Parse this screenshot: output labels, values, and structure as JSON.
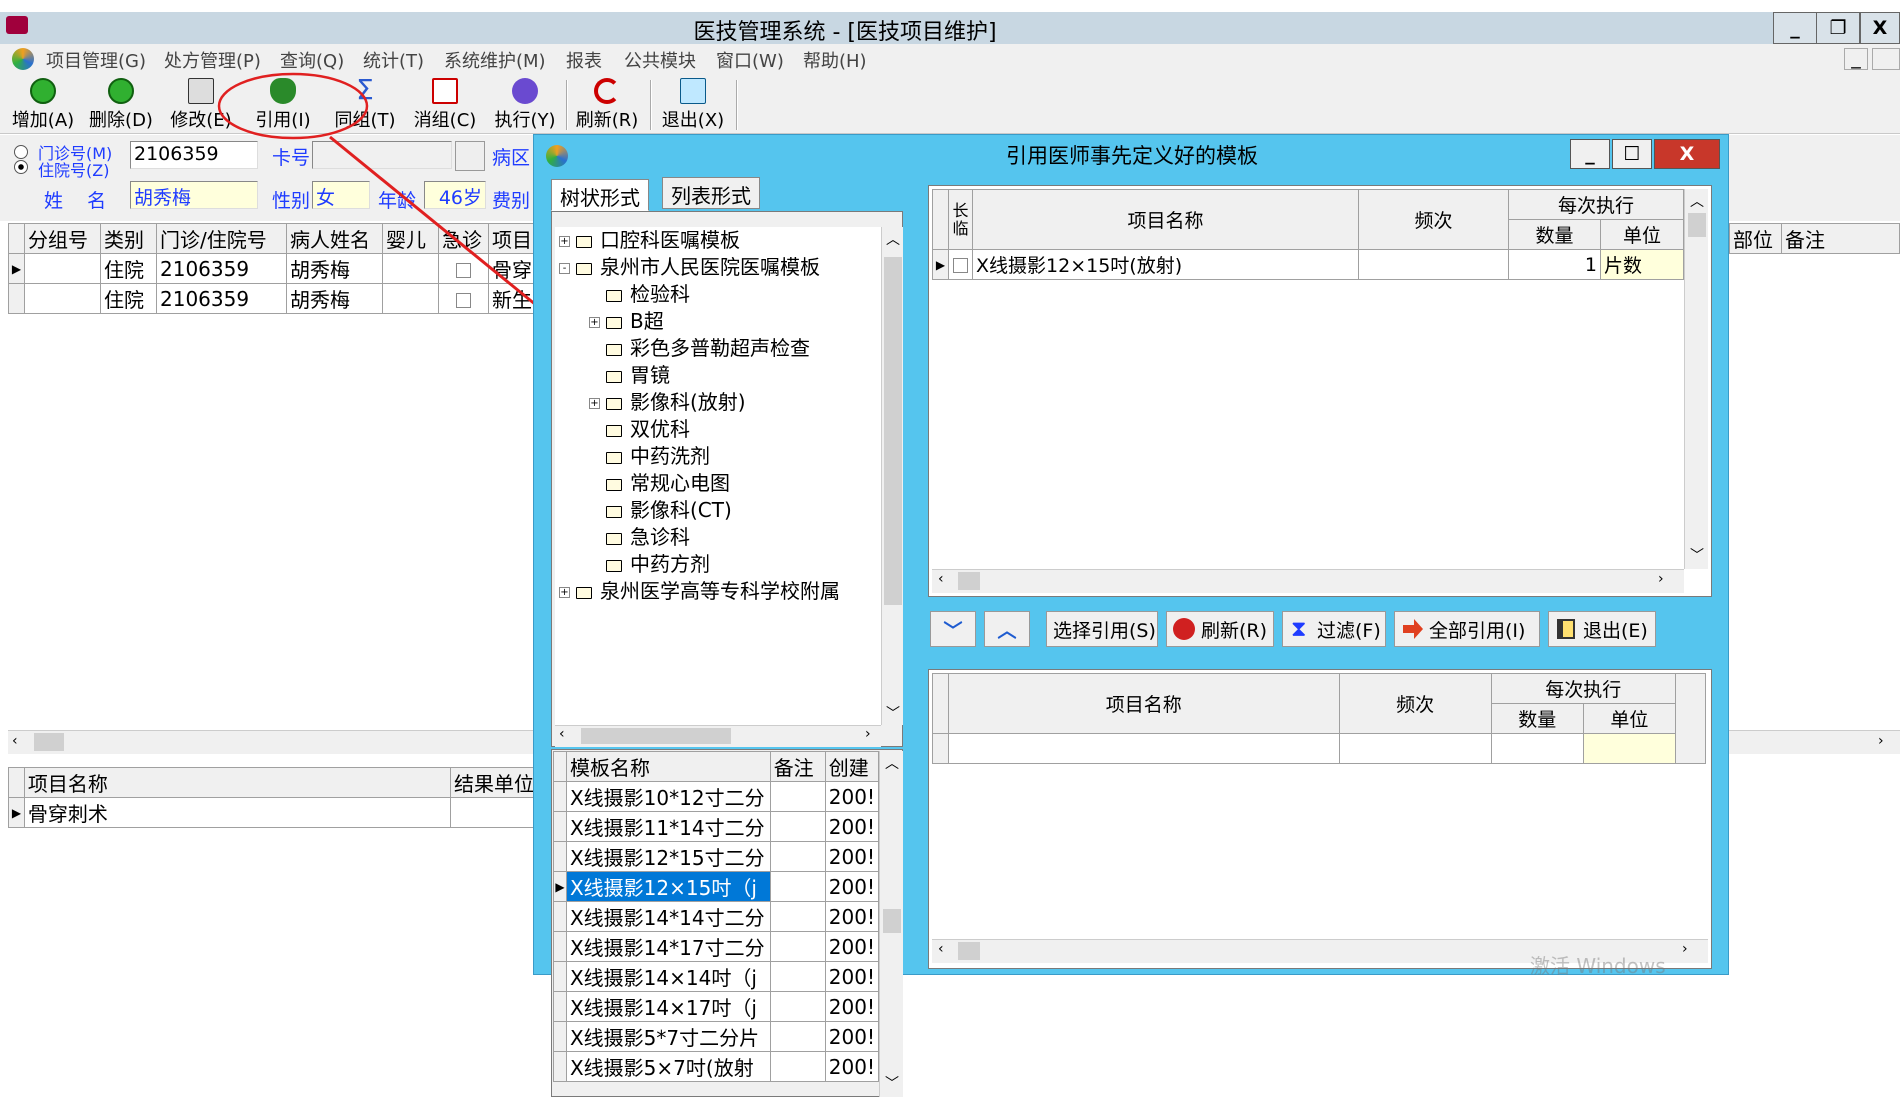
{
  "window": {
    "title": "医技管理系统 - [医技项目维护]",
    "min": "_",
    "max": "❐",
    "close": "X"
  },
  "menu": [
    "项目管理(G)",
    "处方管理(P)",
    "查询(Q)",
    "统计(T)",
    "系统维护(M)",
    "报表",
    "公共模块",
    "窗口(W)",
    "帮助(H)"
  ],
  "toolbar": {
    "add": "增加(A)",
    "delete": "删除(D)",
    "edit": "修改(E)",
    "ref": "引用(I)",
    "group": "同组(T)",
    "cancel": "消组(C)",
    "exec": "执行(Y)",
    "refresh": "刷新(R)",
    "exit": "退出(X)"
  },
  "patient": {
    "outpatient_label": "门诊号(M)",
    "inpatient_label": "住院号(Z)",
    "number": "2106359",
    "card_label": "卡号",
    "card_value": "",
    "ward_label": "病区",
    "name_label": "姓    名",
    "name": "胡秀梅",
    "sex_label": "性别",
    "sex": "女",
    "age_label": "年龄",
    "age": "46岁",
    "fee_label": "费别"
  },
  "main_grid": {
    "headers": [
      "分组号",
      "类别",
      "门诊/住院号",
      "病人姓名",
      "婴儿",
      "急诊",
      "项目"
    ],
    "right_headers": [
      "部位",
      "备注"
    ],
    "rows": [
      [
        "",
        "住院",
        "2106359",
        "胡秀梅",
        "",
        "",
        "骨穿"
      ],
      [
        "",
        "住院",
        "2106359",
        "胡秀梅",
        "",
        "",
        "新生"
      ]
    ]
  },
  "bottom_grid": {
    "headers": [
      "项目名称",
      "结果单位"
    ],
    "rows": [
      [
        "骨穿刺术",
        ""
      ]
    ]
  },
  "dialog": {
    "title": "引用医师事先定义好的模板",
    "tab_tree": "树状形式",
    "tab_list": "列表形式",
    "tree": [
      {
        "label": "口腔科医嘱模板",
        "level": 0,
        "expander": "+"
      },
      {
        "label": "泉州市人民医院医嘱模板",
        "level": 0,
        "expander": "-"
      },
      {
        "label": "检验科",
        "level": 1,
        "expander": ""
      },
      {
        "label": "B超",
        "level": 1,
        "expander": "+"
      },
      {
        "label": "彩色多普勒超声检查",
        "level": 1,
        "expander": ""
      },
      {
        "label": "胃镜",
        "level": 1,
        "expander": ""
      },
      {
        "label": "影像科(放射)",
        "level": 1,
        "expander": "+"
      },
      {
        "label": "双优科",
        "level": 1,
        "expander": ""
      },
      {
        "label": "中药洗剂",
        "level": 1,
        "expander": ""
      },
      {
        "label": "常规心电图",
        "level": 1,
        "expander": ""
      },
      {
        "label": "影像科(CT)",
        "level": 1,
        "expander": ""
      },
      {
        "label": "急诊科",
        "level": 1,
        "expander": ""
      },
      {
        "label": "中药方剂",
        "level": 1,
        "expander": ""
      },
      {
        "label": "泉州医学高等专科学校附属",
        "level": 0,
        "expander": "+"
      }
    ],
    "template_grid": {
      "headers": [
        "模板名称",
        "备注",
        "创建"
      ],
      "rows": [
        [
          "X线摄影10*12寸二分",
          "",
          "200!"
        ],
        [
          "X线摄影11*14寸二分",
          "",
          "200!"
        ],
        [
          "X线摄影12*15寸二分",
          "",
          "200!"
        ],
        [
          "X线摄影12×15吋（j",
          "",
          "200!"
        ],
        [
          "X线摄影14*14寸二分",
          "",
          "200!"
        ],
        [
          "X线摄影14*17寸二分",
          "",
          "200!"
        ],
        [
          "X线摄影14×14吋（j",
          "",
          "200!"
        ],
        [
          "X线摄影14×17吋（j",
          "",
          "200!"
        ],
        [
          "X线摄影5*7寸二分片",
          "",
          "200!"
        ],
        [
          "X线摄影5×7吋(放射",
          "",
          "200!"
        ]
      ],
      "selected_row": 3
    },
    "item_grid": {
      "h_long": "长临",
      "h_name": "项目名称",
      "h_freq": "频次",
      "h_each": "每次执行",
      "h_qty": "数量",
      "h_unit": "单位",
      "rows": [
        [
          "X线摄影12×15吋(放射)",
          "",
          "1",
          "片数"
        ]
      ]
    },
    "buttons": {
      "down": "﹀",
      "up": "︿",
      "select": "选择引用(S)",
      "refresh": "刷新(R)",
      "filter": "过滤(F)",
      "all": "全部引用(I)",
      "exit": "退出(E)"
    },
    "lower_grid": {
      "h_name": "项目名称",
      "h_freq": "频次",
      "h_each": "每次执行",
      "h_qty": "数量",
      "h_unit": "单位"
    }
  },
  "colors": {
    "dialog_bg": "#55c5ee",
    "selection": "#0078d7",
    "label_blue": "#1f3cff",
    "annotation_red": "#e02020"
  },
  "watermark": "激活 Windows"
}
